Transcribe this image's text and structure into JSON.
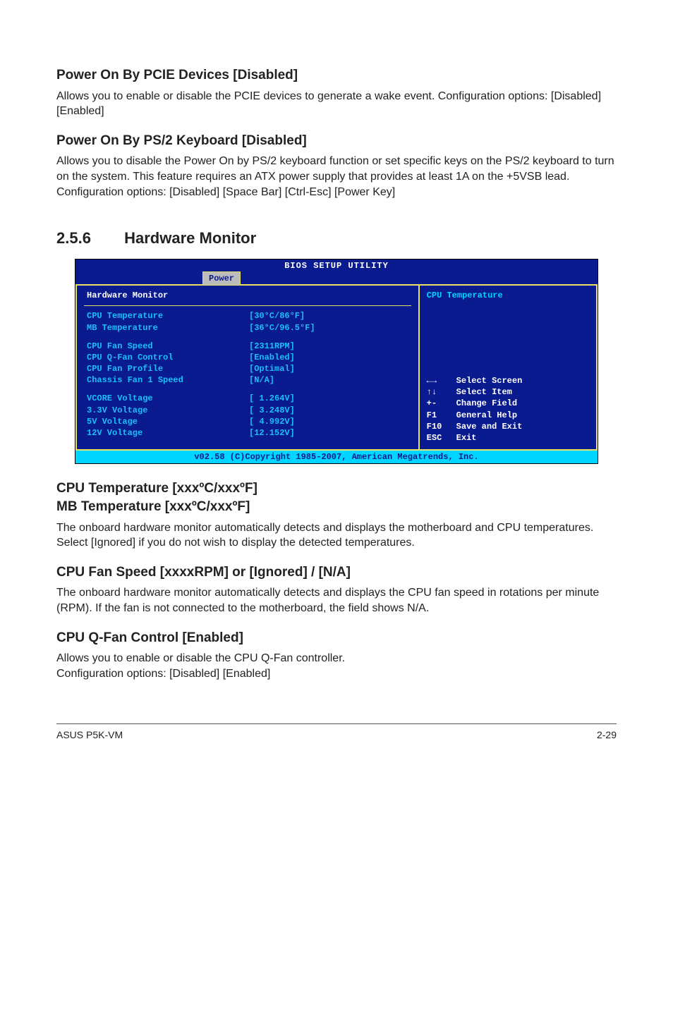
{
  "sections": {
    "pcie": {
      "heading": "Power On By PCIE Devices [Disabled]",
      "text": "Allows you to enable or disable the PCIE devices to generate a wake event. Configuration options: [Disabled] [Enabled]"
    },
    "ps2": {
      "heading": "Power On By PS/2 Keyboard [Disabled]",
      "text": "Allows you to disable the Power On by PS/2 keyboard function or set specific keys on the PS/2 keyboard to turn on the system. This feature requires an ATX power supply that provides at least 1A on the +5VSB lead.\nConfiguration options: [Disabled] [Space Bar] [Ctrl-Esc] [Power Key]"
    }
  },
  "main_heading": {
    "num": "2.5.6",
    "title": "Hardware Monitor"
  },
  "bios": {
    "title": "BIOS SETUP UTILITY",
    "tab": "Power",
    "left_header": "Hardware Monitor",
    "rows_g1": [
      {
        "lbl": "CPU Temperature",
        "val": "[30°C/86°F]"
      },
      {
        "lbl": "MB Temperature",
        "val": "[36°C/96.5°F]"
      }
    ],
    "rows_g2": [
      {
        "lbl": "CPU Fan Speed",
        "val": "[2311RPM]"
      },
      {
        "lbl": "CPU Q-Fan Control",
        "val": "[Enabled]"
      },
      {
        "lbl": "CPU Fan Profile",
        "val": "[Optimal]"
      },
      {
        "lbl": "Chassis Fan 1 Speed",
        "val": "[N/A]"
      }
    ],
    "rows_g3": [
      {
        "lbl": "VCORE Voltage",
        "val": "[ 1.264V]"
      },
      {
        "lbl": "3.3V Voltage",
        "val": "[ 3.248V]"
      },
      {
        "lbl": "5V Voltage",
        "val": "[ 4.992V]"
      },
      {
        "lbl": "12V Voltage",
        "val": "[12.152V]"
      }
    ],
    "help_top": "CPU Temperature",
    "nav": [
      {
        "key": "←→",
        "desc": "Select Screen"
      },
      {
        "key": "↑↓",
        "desc": "Select Item"
      },
      {
        "key": "+-",
        "desc": "Change Field"
      },
      {
        "key": "F1",
        "desc": "General Help"
      },
      {
        "key": "F10",
        "desc": "Save and Exit"
      },
      {
        "key": "ESC",
        "desc": "Exit"
      }
    ],
    "footer": "v02.58 (C)Copyright 1985-2007, American Megatrends, Inc."
  },
  "after": {
    "temp": {
      "heading1": "CPU Temperature [xxxºC/xxxºF]",
      "heading2": "MB Temperature [xxxºC/xxxºF]",
      "text": "The onboard hardware monitor automatically detects and displays the motherboard and CPU temperatures. Select [Ignored] if you do not wish to display the detected temperatures."
    },
    "fan": {
      "heading": "CPU Fan Speed [xxxxRPM] or [Ignored] / [N/A]",
      "text": "The onboard hardware monitor automatically detects and displays the CPU fan speed in rotations per minute (RPM). If the fan is not connected to the motherboard, the field shows N/A."
    },
    "qfan": {
      "heading": "CPU Q-Fan Control [Enabled]",
      "text": "Allows you to enable or disable the CPU Q-Fan controller.\nConfiguration options: [Disabled] [Enabled]"
    }
  },
  "footer": {
    "left": "ASUS P5K-VM",
    "right": "2-29"
  }
}
